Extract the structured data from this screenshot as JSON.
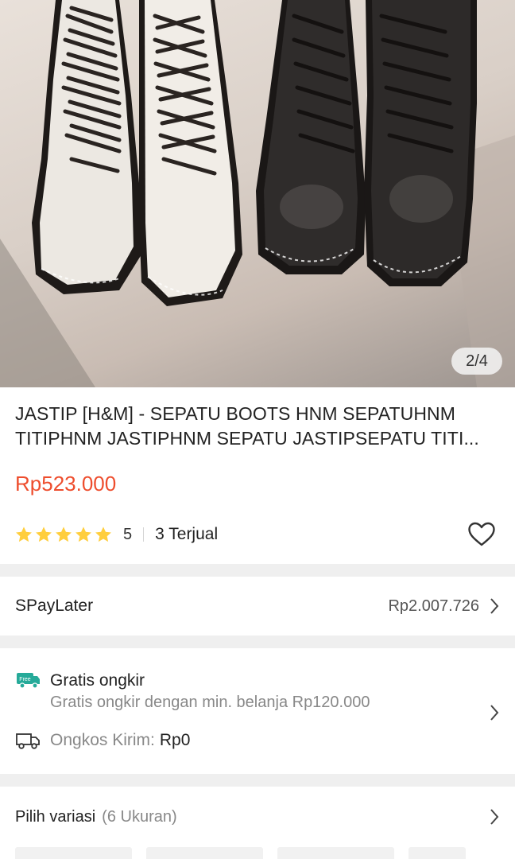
{
  "gallery": {
    "counter": "2/4"
  },
  "product": {
    "title": "JASTIP [H&M] - SEPATU BOOTS HNM SEPATUHNM TITIPHNM JASTIPHNM SEPATU JASTIPSEPATU TITI...",
    "price": "Rp523.000",
    "rating": "5",
    "sold": "3 Terjual",
    "rating_stars": 5
  },
  "spaylater": {
    "label": "SPayLater",
    "amount": "Rp2.007.726"
  },
  "shipping": {
    "free_badge": "Free",
    "title": "Gratis ongkir",
    "subtitle": "Gratis ongkir dengan min. belanja Rp120.000",
    "cost_label": "Ongkos Kirim:",
    "cost_value": "Rp0"
  },
  "variant": {
    "label": "Pilih variasi",
    "count": "(6 Ukuran)"
  },
  "colors": {
    "price": "#ee4d2d",
    "star": "#ffce3d",
    "free_badge": "#26aa99"
  },
  "icons": [
    "star-icon",
    "heart-icon",
    "chevron-right-icon",
    "free-shipping-icon",
    "truck-icon"
  ]
}
